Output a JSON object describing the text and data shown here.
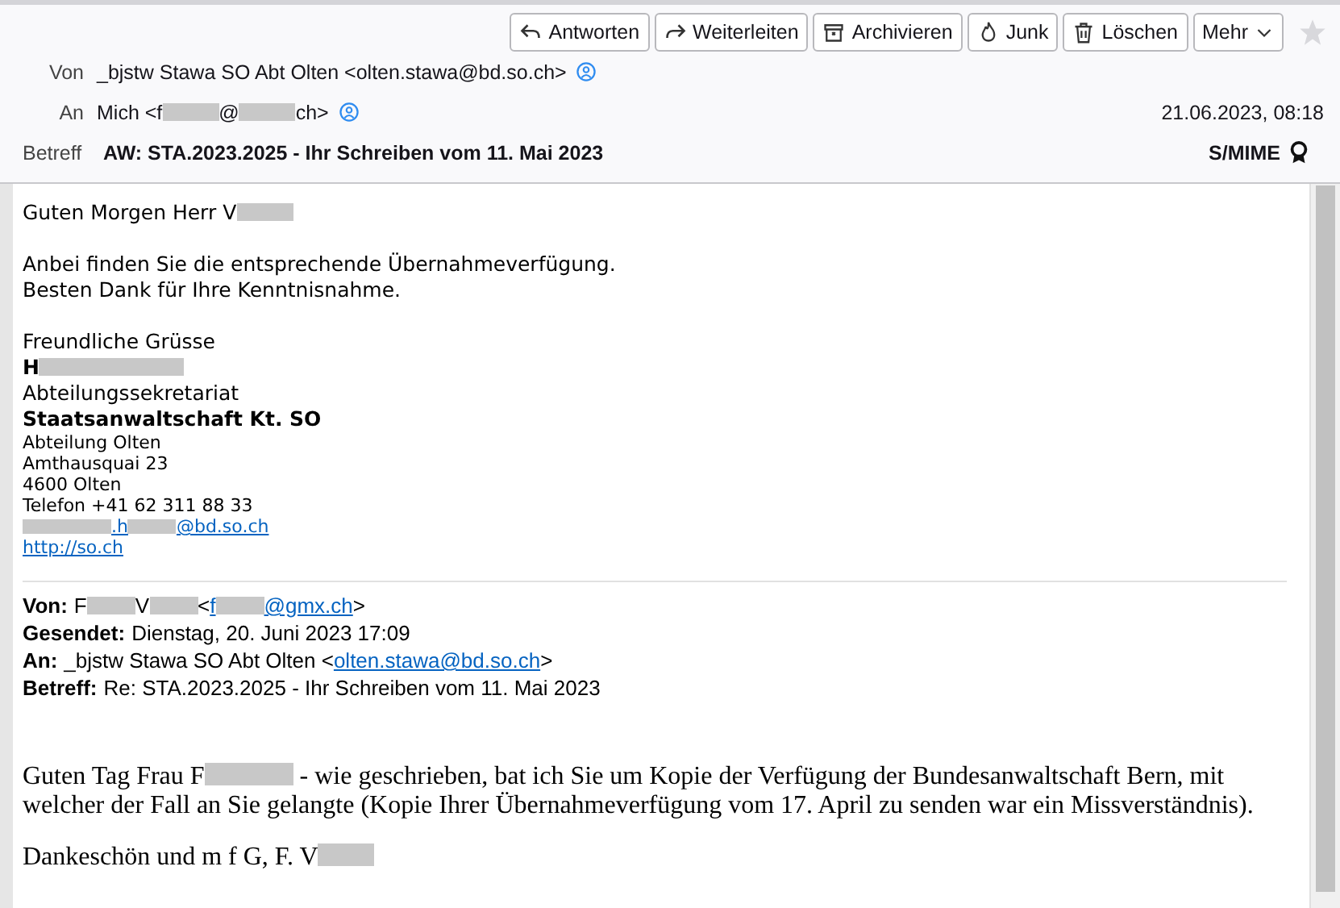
{
  "toolbar": {
    "buttons": [
      {
        "label": "Antworten",
        "kind": "reply"
      },
      {
        "label": "Weiterleiten",
        "kind": "forward"
      },
      {
        "label": "Archivieren",
        "kind": "archive"
      },
      {
        "label": "Junk",
        "kind": "junk"
      },
      {
        "label": "Löschen",
        "kind": "delete"
      },
      {
        "label": "Mehr",
        "kind": "more"
      }
    ]
  },
  "header": {
    "from": {
      "label": "Von",
      "parts": [
        {
          "kind": "text",
          "text": "_bjstw Stawa SO Abt Olten <olten.stawa@bd.so.ch>"
        }
      ]
    },
    "to": {
      "label": "An",
      "parts": [
        {
          "kind": "text",
          "text": "Mich <f"
        },
        {
          "kind": "mask"
        },
        {
          "kind": "text",
          "text": "@"
        },
        {
          "kind": "mask"
        },
        {
          "kind": "text",
          "text": "ch>"
        }
      ]
    },
    "date": "21.06.2023, 08:18",
    "subject": {
      "label": "Betreff",
      "value": "AW: STA.2023.2025 - Ihr Schreiben vom 11. Mai 2023"
    },
    "security": "S/MIME"
  },
  "body": {
    "lines": [
      {
        "kind": "plain",
        "parts": [
          {
            "kind": "text",
            "text": "Guten Morgen Herr V"
          },
          {
            "kind": "mask"
          }
        ]
      },
      {
        "kind": "blank"
      },
      {
        "kind": "plain",
        "parts": [
          {
            "kind": "text",
            "text": "Anbei finden Sie die entsprechende Übernahmeverfügung."
          }
        ]
      },
      {
        "kind": "plain",
        "parts": [
          {
            "kind": "text",
            "text": "Besten Dank für Ihre Kenntnisnahme."
          }
        ]
      },
      {
        "kind": "blank"
      },
      {
        "kind": "plain",
        "parts": [
          {
            "kind": "text",
            "text": "Freundliche Grüsse"
          }
        ]
      },
      {
        "kind": "strong",
        "parts": [
          {
            "kind": "text",
            "text": "H"
          },
          {
            "kind": "mask"
          },
          {
            "kind": "widemask"
          }
        ]
      },
      {
        "kind": "plain",
        "parts": [
          {
            "kind": "text",
            "text": "Abteilungssekretariat"
          }
        ]
      },
      {
        "kind": "strong",
        "parts": [
          {
            "kind": "text",
            "text": "Staatsanwaltschaft Kt. SO"
          }
        ]
      },
      {
        "kind": "small",
        "parts": [
          {
            "kind": "text",
            "text": "Abteilung Olten"
          }
        ]
      },
      {
        "kind": "small",
        "parts": [
          {
            "kind": "text",
            "text": "Amthausquai 23"
          }
        ]
      },
      {
        "kind": "small",
        "parts": [
          {
            "kind": "text",
            "text": "4600 Olten"
          }
        ]
      },
      {
        "kind": "small",
        "parts": [
          {
            "kind": "text",
            "text": "Telefon +41 62 311 88 33"
          }
        ]
      },
      {
        "kind": "small",
        "parts": [
          {
            "kind": "link",
            "parts": [
              {
                "kind": "widemask"
              },
              {
                "kind": "text",
                "text": ".h"
              },
              {
                "kind": "narrowmask"
              },
              {
                "kind": "text",
                "text": "@bd.so.ch"
              }
            ]
          }
        ]
      },
      {
        "kind": "small",
        "parts": [
          {
            "kind": "link",
            "parts": [
              {
                "kind": "text",
                "text": "http://so.ch"
              }
            ]
          }
        ]
      }
    ]
  },
  "quote_header": [
    {
      "label": "Von:",
      "parts": [
        {
          "kind": "text",
          "text": "F"
        },
        {
          "kind": "narrowmask"
        },
        {
          "kind": "text",
          "text": "V"
        },
        {
          "kind": "narrowmask"
        },
        {
          "kind": "text",
          "text": "<"
        },
        {
          "kind": "link",
          "parts": [
            {
              "kind": "text",
              "text": "f"
            },
            {
              "kind": "narrowmask"
            },
            {
              "kind": "text",
              "text": "@gmx.ch"
            }
          ]
        },
        {
          "kind": "text",
          "text": ">"
        }
      ]
    },
    {
      "label": "Gesendet:",
      "parts": [
        {
          "kind": "text",
          "text": "Dienstag, 20. Juni 2023 17:09"
        }
      ]
    },
    {
      "label": "An:",
      "parts": [
        {
          "kind": "text",
          "text": "_bjstw Stawa SO Abt Olten <"
        },
        {
          "kind": "link",
          "parts": [
            {
              "kind": "text",
              "text": "olten.stawa@bd.so.ch"
            }
          ]
        },
        {
          "kind": "text",
          "text": ">"
        }
      ]
    },
    {
      "label": "Betreff:",
      "parts": [
        {
          "kind": "text",
          "text": "Re: STA.2023.2025 - Ihr Schreiben vom 11. Mai 2023"
        }
      ]
    }
  ],
  "quote_body": [
    {
      "parts": [
        {
          "kind": "text",
          "text": "Guten Tag Frau F"
        },
        {
          "kind": "widemask"
        },
        {
          "kind": "text",
          "text": " - wie geschrieben, bat ich Sie um Kopie der Verfügung der Bundesanwaltschaft Bern, mit welcher der Fall an Sie gelangte (Kopie Ihrer Übernahmeverfügung vom 17. April zu senden war ein Missverständnis)."
        }
      ]
    },
    {
      "parts": [
        {
          "kind": "text",
          "text": "Dankeschön und m f G, F. V"
        },
        {
          "kind": "mask"
        }
      ]
    }
  ]
}
